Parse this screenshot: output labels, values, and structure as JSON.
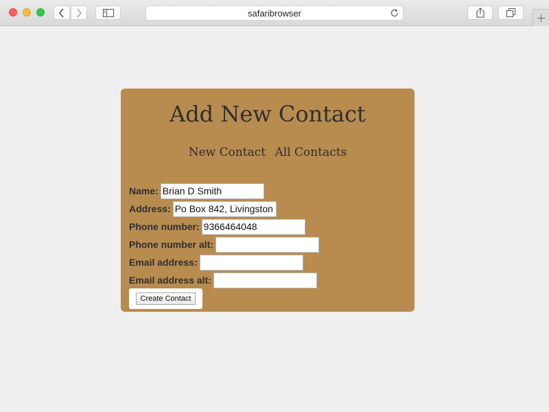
{
  "browser": {
    "url": "safaribrowser",
    "icons": {
      "back": "chevron-left-icon",
      "forward": "chevron-right-icon",
      "sidebar": "sidebar-icon",
      "reload": "reload-icon",
      "share": "share-icon",
      "tabs": "tabs-icon",
      "new_tab": "plus-icon"
    }
  },
  "page": {
    "title": "Add New Contact",
    "nav": [
      "New Contact",
      "All Contacts"
    ],
    "background_color": "#b88b4f",
    "form": {
      "fields": [
        {
          "label": "Name:",
          "value": "Brian D Smith"
        },
        {
          "label": "Address:",
          "value": "Po Box 842, Livingston"
        },
        {
          "label": "Phone number:",
          "value": "9366464048"
        },
        {
          "label": "Phone number alt:",
          "value": ""
        },
        {
          "label": "Email address:",
          "value": ""
        },
        {
          "label": "Email address alt:",
          "value": ""
        }
      ],
      "submit_label": "Create Contact"
    }
  }
}
